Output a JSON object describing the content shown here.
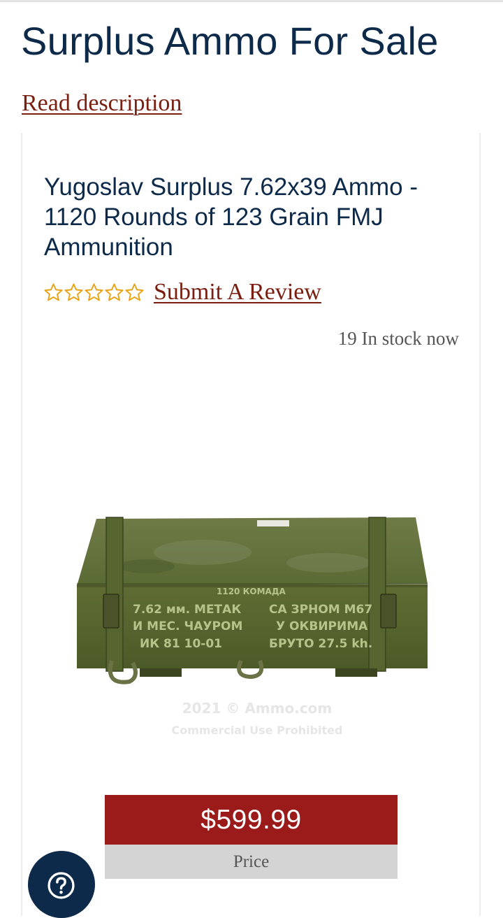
{
  "page": {
    "title": "Surplus Ammo For Sale",
    "read_description": "Read description"
  },
  "product": {
    "title": "Yugoslav Surplus 7.62x39 Ammo - 1120 Rounds of 123 Grain FMJ Ammunition",
    "rating": {
      "stars_filled": 0,
      "stars_total": 5
    },
    "submit_review": "Submit A Review",
    "stock": "19 In stock now",
    "image": {
      "icon": "ammo-crate-image",
      "crate_text_lines": [
        "1120 КОМАДА",
        "7.62 мм. МЕТАК",
        "СА ЗРНОМ М67",
        "И МЕС. ЧАУРОМ",
        "У ОКВИРИМА",
        "ИК 81 10-01",
        "БРУТО 27.5 kh."
      ],
      "watermark_line1": "2021 © Ammo.com",
      "watermark_line2": "Commercial Use Prohibited"
    },
    "price": "$599.99",
    "price_label": "Price"
  },
  "help": {
    "icon": "question-icon"
  },
  "colors": {
    "navy": "#0d2a4a",
    "link_red": "#7a1f10",
    "price_red": "#9b1b1b",
    "star_gold": "#e8a317",
    "label_gray": "#d4d4d4"
  }
}
